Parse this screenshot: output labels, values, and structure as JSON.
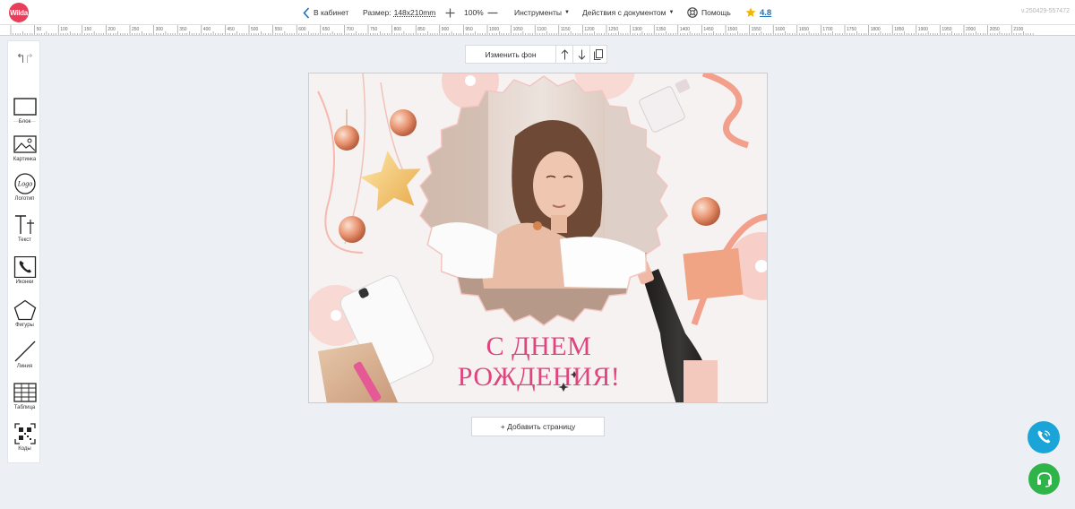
{
  "app": {
    "logo_text": "Wilda",
    "version": "v.250429-557472"
  },
  "header": {
    "back_label": "В кабинет",
    "size_label": "Размер:",
    "size_value": "148x210mm",
    "zoom_value": "100%",
    "tools_label": "Инструменты",
    "doc_actions_label": "Действия с документом",
    "help_label": "Помощь",
    "rating_value": "4.8"
  },
  "ruler": {
    "labels": [
      "50",
      "100",
      "150",
      "200",
      "250",
      "300",
      "350",
      "400",
      "450",
      "500",
      "550",
      "600",
      "650",
      "700",
      "750",
      "800",
      "850",
      "900",
      "950",
      "1000",
      "1050",
      "1100",
      "1150",
      "1200",
      "1250",
      "1300",
      "1350",
      "1400",
      "1450",
      "1500",
      "1550",
      "1600",
      "1650",
      "1700",
      "1750",
      "1800",
      "1850",
      "1900",
      "1950",
      "2000",
      "2050",
      "2100"
    ]
  },
  "sidebar": {
    "tools": [
      {
        "label": "Блок",
        "icon": "rectangle-icon"
      },
      {
        "label": "Картинка",
        "icon": "image-icon"
      },
      {
        "label": "Логотип",
        "icon": "logo-icon"
      },
      {
        "label": "Текст",
        "icon": "text-icon"
      },
      {
        "label": "Иконки",
        "icon": "phone-icon"
      },
      {
        "label": "Фигуры",
        "icon": "pentagon-icon"
      },
      {
        "label": "Линия",
        "icon": "line-icon"
      },
      {
        "label": "Таблица",
        "icon": "table-icon"
      },
      {
        "label": "Коды",
        "icon": "qr-code-icon"
      }
    ],
    "logo_icon_text": "Logo"
  },
  "canvas_toolbar": {
    "change_bg_label": "Изменить фон"
  },
  "page": {
    "greeting_line1": "С ДНЕМ",
    "greeting_line2": "РОЖДЕНИЯ!"
  },
  "add_page_label": "+ Добавить страницу",
  "colors": {
    "accent": "#e83e5a",
    "greeting": "#e0447e",
    "phone_fab": "#1aa4d8",
    "support_fab": "#2fb44a",
    "rating_link": "#1f6fb8",
    "star": "#f5b400"
  }
}
